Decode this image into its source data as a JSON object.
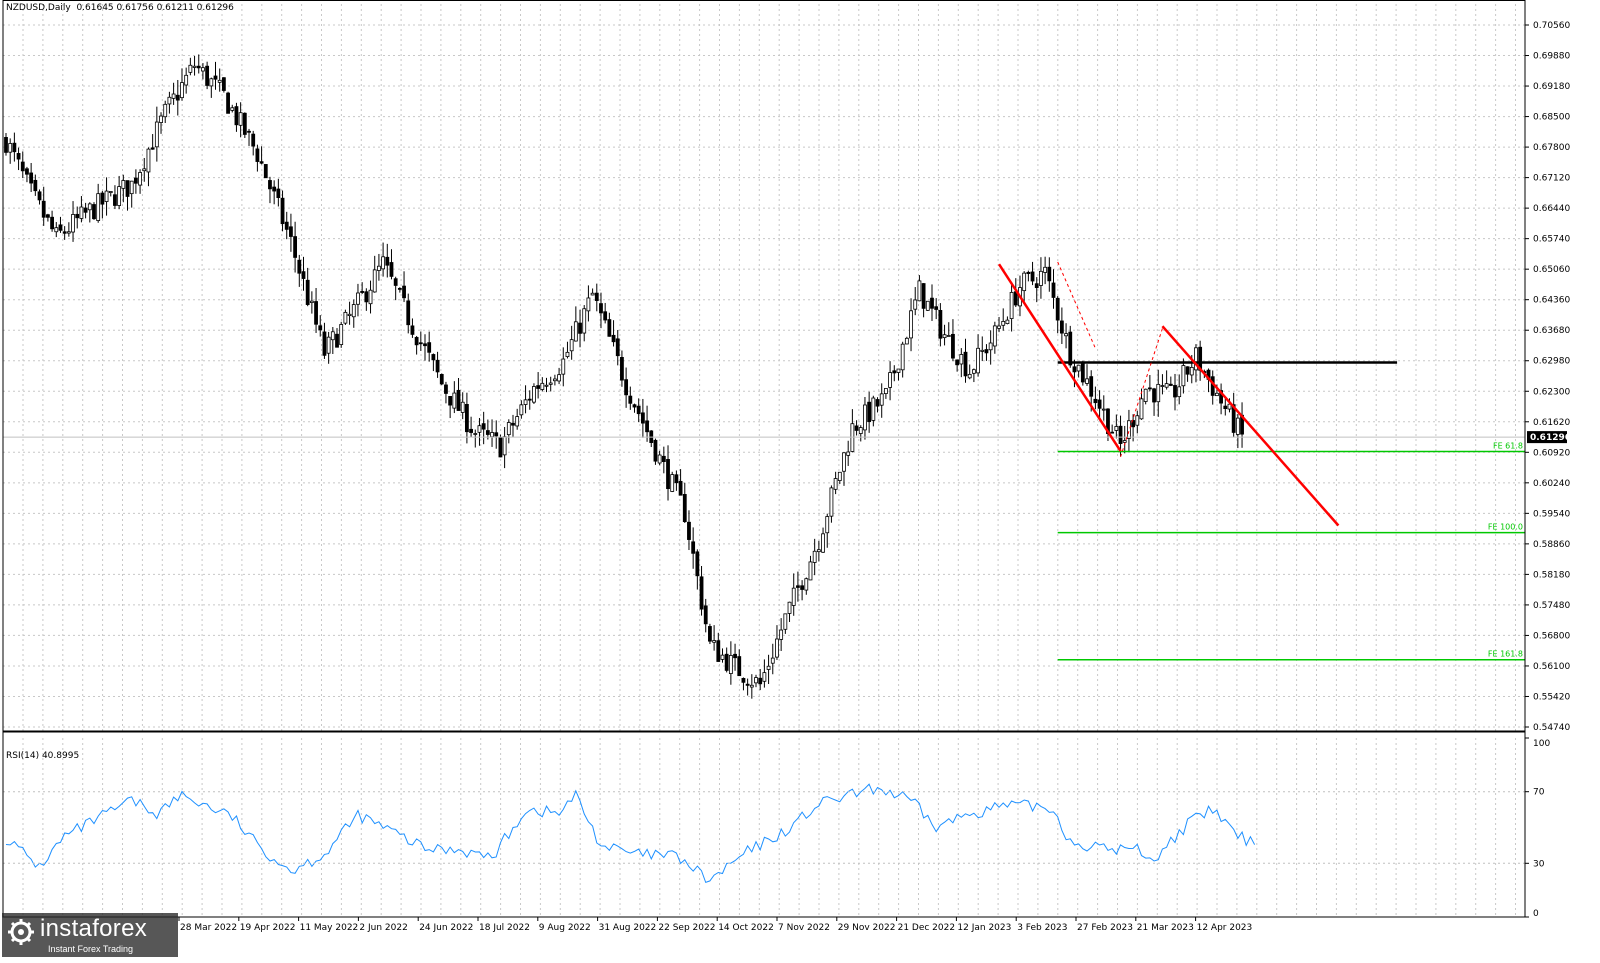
{
  "header": {
    "symbol": "NZDUSD,Daily",
    "ohlc": "0.61645 0.61756 0.61211 0.61296"
  },
  "rsi_header": "RSI(14) 40.8995",
  "current_price_label": "0.61296",
  "logo": {
    "word": "instaforex",
    "sub": "Instant Forex Trading"
  },
  "colors": {
    "candle": "#000000",
    "grid": "#c8c8c8",
    "rsi_line": "#1e90ff",
    "fe_lines": "#00c800",
    "channel": "#ff0000",
    "resistance": "#000000"
  },
  "chart_data": [
    {
      "type": "candlestick",
      "symbol": "NZDUSD",
      "timeframe": "Daily",
      "yticks": [
        "0.70560",
        "0.69880",
        "0.69180",
        "0.68500",
        "0.67800",
        "0.67120",
        "0.66440",
        "0.65740",
        "0.65060",
        "0.64360",
        "0.63680",
        "0.62980",
        "0.62300",
        "0.61620",
        "0.60920",
        "0.60240",
        "0.59540",
        "0.58860",
        "0.58180",
        "0.57480",
        "0.56800",
        "0.56100",
        "0.55420",
        "0.54740"
      ],
      "ylim": [
        0.5466,
        0.7085
      ],
      "xticks": [
        "28 Mar 2022",
        "19 Apr 2022",
        "11 May 2022",
        "2 Jun 2022",
        "24 Jun 2022",
        "18 Jul 2022",
        "9 Aug 2022",
        "31 Aug 2022",
        "22 Sep 2022",
        "14 Oct 2022",
        "7 Nov 2022",
        "29 Nov 2022",
        "21 Dec 2022",
        "12 Jan 2023",
        "3 Feb 2023",
        "27 Feb 2023",
        "21 Mar 2023",
        "12 Apr 2023"
      ],
      "anchors": [
        {
          "i": 0,
          "close": 0.68
        },
        {
          "i": 6,
          "close": 0.668
        },
        {
          "i": 12,
          "close": 0.658
        },
        {
          "i": 20,
          "close": 0.664
        },
        {
          "i": 30,
          "close": 0.67
        },
        {
          "i": 38,
          "close": 0.686
        },
        {
          "i": 45,
          "close": 0.697
        },
        {
          "i": 52,
          "close": 0.69
        },
        {
          "i": 60,
          "close": 0.677
        },
        {
          "i": 68,
          "close": 0.657
        },
        {
          "i": 76,
          "close": 0.632
        },
        {
          "i": 82,
          "close": 0.64
        },
        {
          "i": 90,
          "close": 0.652
        },
        {
          "i": 96,
          "close": 0.64
        },
        {
          "i": 104,
          "close": 0.625
        },
        {
          "i": 112,
          "close": 0.614
        },
        {
          "i": 118,
          "close": 0.611
        },
        {
          "i": 126,
          "close": 0.624
        },
        {
          "i": 133,
          "close": 0.63
        },
        {
          "i": 140,
          "close": 0.645
        },
        {
          "i": 148,
          "close": 0.625
        },
        {
          "i": 156,
          "close": 0.608
        },
        {
          "i": 162,
          "close": 0.596
        },
        {
          "i": 168,
          "close": 0.566
        },
        {
          "i": 174,
          "close": 0.561
        },
        {
          "i": 180,
          "close": 0.557
        },
        {
          "i": 186,
          "close": 0.572
        },
        {
          "i": 194,
          "close": 0.59
        },
        {
          "i": 202,
          "close": 0.615
        },
        {
          "i": 210,
          "close": 0.622
        },
        {
          "i": 218,
          "close": 0.646
        },
        {
          "i": 224,
          "close": 0.636
        },
        {
          "i": 230,
          "close": 0.628
        },
        {
          "i": 236,
          "close": 0.636
        },
        {
          "i": 242,
          "close": 0.647
        },
        {
          "i": 248,
          "close": 0.65
        },
        {
          "i": 254,
          "close": 0.632
        },
        {
          "i": 260,
          "close": 0.622
        },
        {
          "i": 266,
          "close": 0.611
        },
        {
          "i": 272,
          "close": 0.624
        },
        {
          "i": 278,
          "close": 0.622
        },
        {
          "i": 284,
          "close": 0.631
        },
        {
          "i": 290,
          "close": 0.621
        },
        {
          "i": 295,
          "close": 0.613
        }
      ],
      "levels": [
        {
          "name": "FE 61.8",
          "price": 0.6097
        },
        {
          "name": "FE 100.0",
          "price": 0.5914
        },
        {
          "name": "FE 161.8",
          "price": 0.5627
        }
      ],
      "resistance": {
        "price": 0.6298,
        "from_bar": 251,
        "to_bar": 332
      },
      "channel_lines": [
        {
          "from": {
            "bar": 237,
            "price": 0.652
          },
          "to": {
            "bar": 266,
            "price": 0.6098
          }
        },
        {
          "from": {
            "bar": 276,
            "price": 0.638
          },
          "to": {
            "bar": 318,
            "price": 0.593
          }
        }
      ],
      "current_price": 0.61296
    },
    {
      "type": "line",
      "name": "RSI(14)",
      "last_value": 40.8995,
      "yticks": [
        "100",
        "70",
        "30",
        "0"
      ],
      "ylim": [
        0,
        100
      ],
      "anchors": [
        {
          "i": 0,
          "v": 44
        },
        {
          "i": 8,
          "v": 28
        },
        {
          "i": 14,
          "v": 45
        },
        {
          "i": 22,
          "v": 55
        },
        {
          "i": 30,
          "v": 65
        },
        {
          "i": 36,
          "v": 58
        },
        {
          "i": 42,
          "v": 68
        },
        {
          "i": 48,
          "v": 62
        },
        {
          "i": 54,
          "v": 56
        },
        {
          "i": 60,
          "v": 40
        },
        {
          "i": 68,
          "v": 26
        },
        {
          "i": 76,
          "v": 35
        },
        {
          "i": 84,
          "v": 57
        },
        {
          "i": 92,
          "v": 48
        },
        {
          "i": 100,
          "v": 38
        },
        {
          "i": 108,
          "v": 38
        },
        {
          "i": 116,
          "v": 33
        },
        {
          "i": 124,
          "v": 60
        },
        {
          "i": 132,
          "v": 58
        },
        {
          "i": 136,
          "v": 68
        },
        {
          "i": 142,
          "v": 40
        },
        {
          "i": 150,
          "v": 35
        },
        {
          "i": 160,
          "v": 34
        },
        {
          "i": 168,
          "v": 20
        },
        {
          "i": 176,
          "v": 35
        },
        {
          "i": 186,
          "v": 48
        },
        {
          "i": 194,
          "v": 63
        },
        {
          "i": 200,
          "v": 67
        },
        {
          "i": 208,
          "v": 72
        },
        {
          "i": 216,
          "v": 65
        },
        {
          "i": 222,
          "v": 50
        },
        {
          "i": 230,
          "v": 58
        },
        {
          "i": 238,
          "v": 62
        },
        {
          "i": 246,
          "v": 62
        },
        {
          "i": 250,
          "v": 60
        },
        {
          "i": 254,
          "v": 42
        },
        {
          "i": 262,
          "v": 38
        },
        {
          "i": 270,
          "v": 38
        },
        {
          "i": 274,
          "v": 32
        },
        {
          "i": 282,
          "v": 52
        },
        {
          "i": 288,
          "v": 60
        },
        {
          "i": 294,
          "v": 45
        },
        {
          "i": 298,
          "v": 41
        }
      ]
    }
  ]
}
